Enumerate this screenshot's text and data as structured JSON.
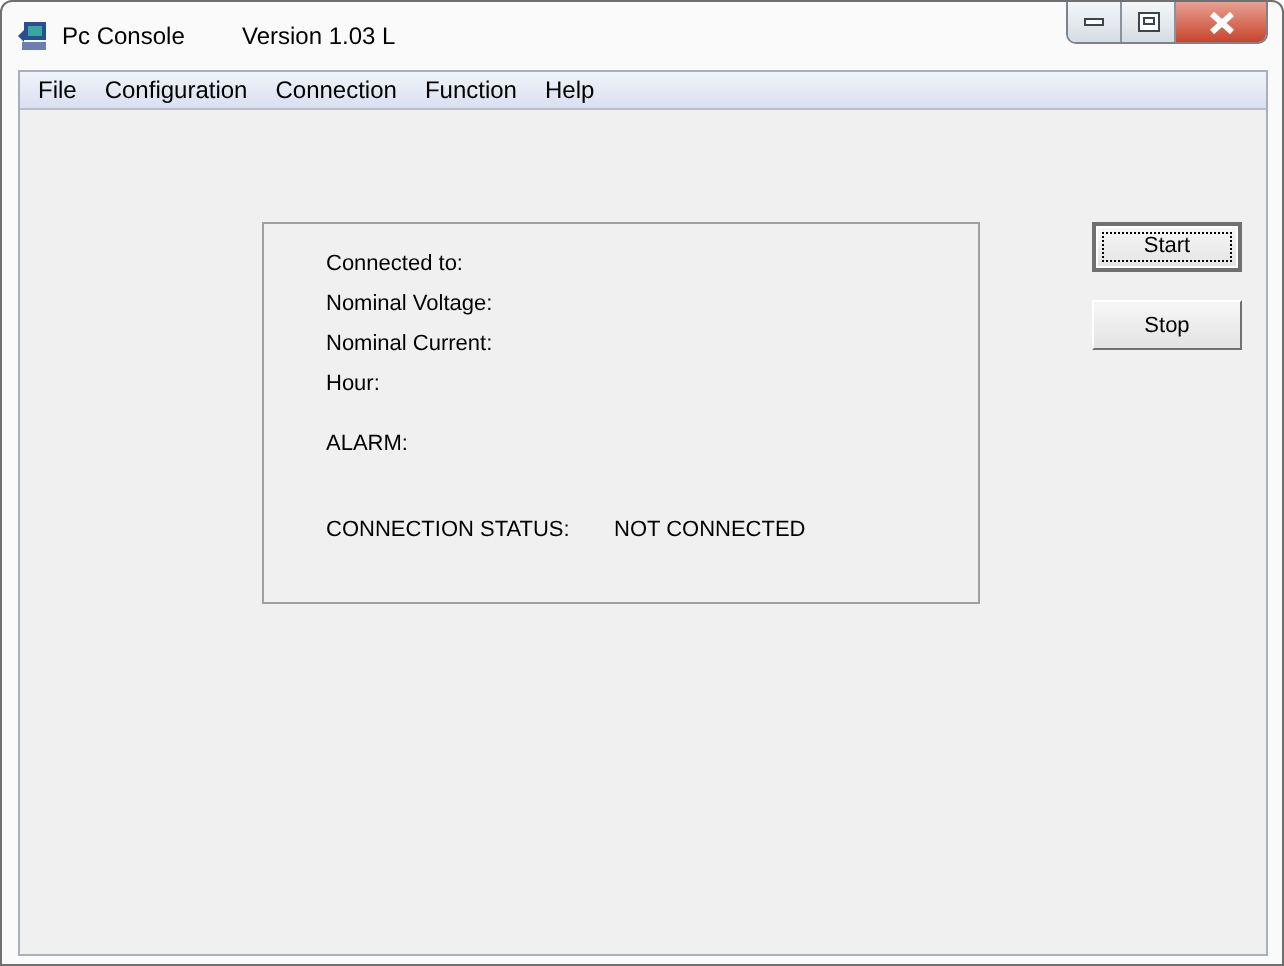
{
  "window": {
    "title": "Pc Console",
    "version": "Version 1.03 L"
  },
  "menu": [
    "File",
    "Configuration",
    "Connection",
    "Function",
    "Help"
  ],
  "panel": {
    "fields": [
      "Connected to:",
      "Nominal Voltage:",
      "Nominal Current:",
      "Hour:"
    ],
    "alarm_label": "ALARM:",
    "status_label": "CONNECTION STATUS:",
    "status_value": "NOT CONNECTED"
  },
  "buttons": [
    {
      "label": "Start",
      "focused": true
    },
    {
      "label": "Stop",
      "focused": false
    }
  ]
}
